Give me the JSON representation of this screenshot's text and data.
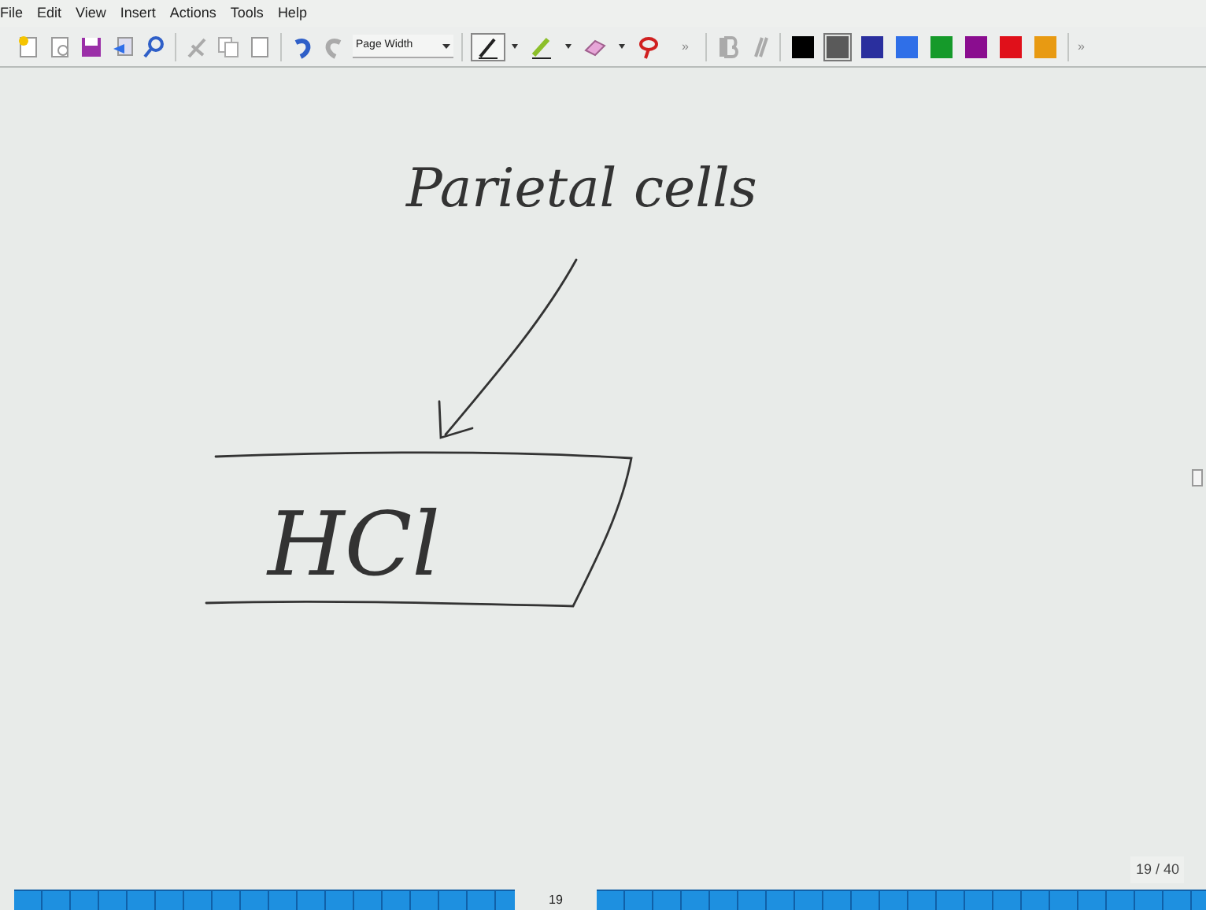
{
  "menu": [
    "File",
    "Edit",
    "View",
    "Insert",
    "Actions",
    "Tools",
    "Help"
  ],
  "toolbar": {
    "zoom": "Page Width",
    "overflow_1": "»",
    "overflow_2": "»",
    "tools": [
      {
        "kind": "pen",
        "selected": true
      },
      {
        "kind": "highlighter",
        "selected": false
      },
      {
        "kind": "eraser",
        "selected": false
      },
      {
        "kind": "lasso",
        "selected": false
      }
    ],
    "swatches": [
      {
        "color": "#000000",
        "selected": false
      },
      {
        "color": "#5a5a5a",
        "selected": true
      },
      {
        "color": "#2a2f9e",
        "selected": false
      },
      {
        "color": "#2f6fe8",
        "selected": false
      },
      {
        "color": "#159a2a",
        "selected": false
      },
      {
        "color": "#8a0d8f",
        "selected": false
      },
      {
        "color": "#e0101a",
        "selected": false
      },
      {
        "color": "#e89a12",
        "selected": false
      }
    ]
  },
  "note": {
    "label": "Parietal cells",
    "formula": "HCl"
  },
  "page_indicator": "19 / 40",
  "page_number": "19"
}
